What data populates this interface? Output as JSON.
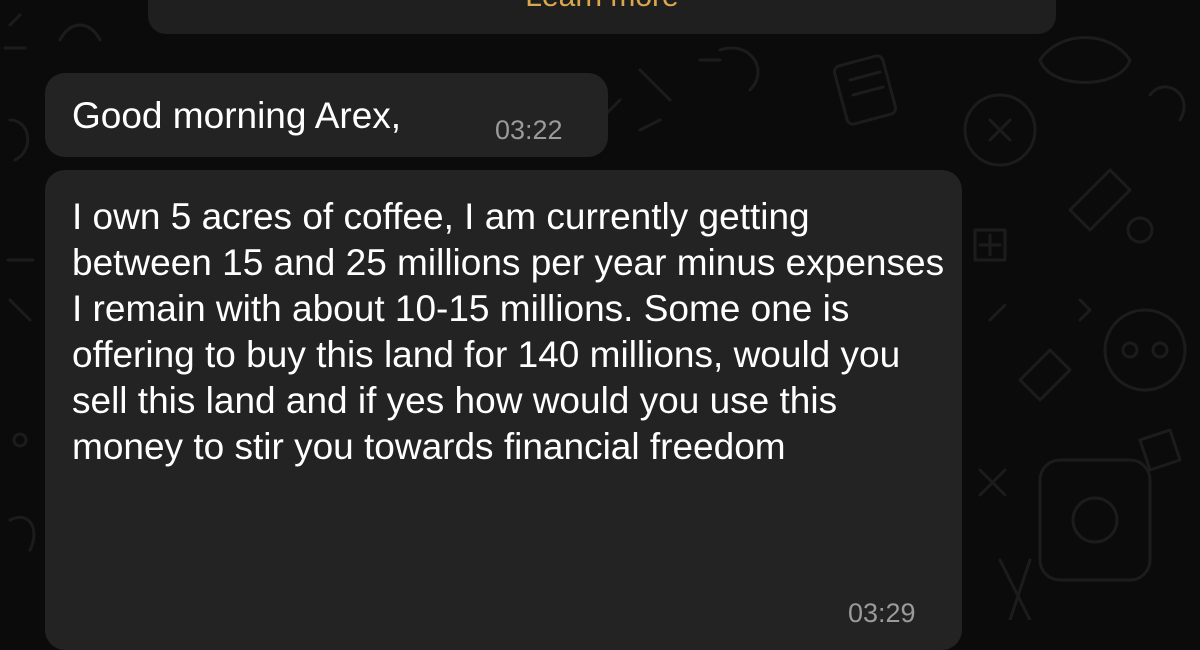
{
  "banner": {
    "link_label": "Learn more"
  },
  "messages": [
    {
      "text": "Good morning Arex,",
      "time": "03:22"
    },
    {
      "text": "I own 5 acres of coffee, I am currently getting between 15 and 25 millions per year minus expenses I remain with about 10-15 millions. Some one is offering to buy this land for 140 millions, would you sell this land and if yes how would you use this money to stir you towards financial freedom",
      "time": "03:29"
    }
  ],
  "colors": {
    "background": "#0b0b0b",
    "bubble": "#232323",
    "link": "#d9a84a",
    "timestamp": "#9a9a9a"
  }
}
